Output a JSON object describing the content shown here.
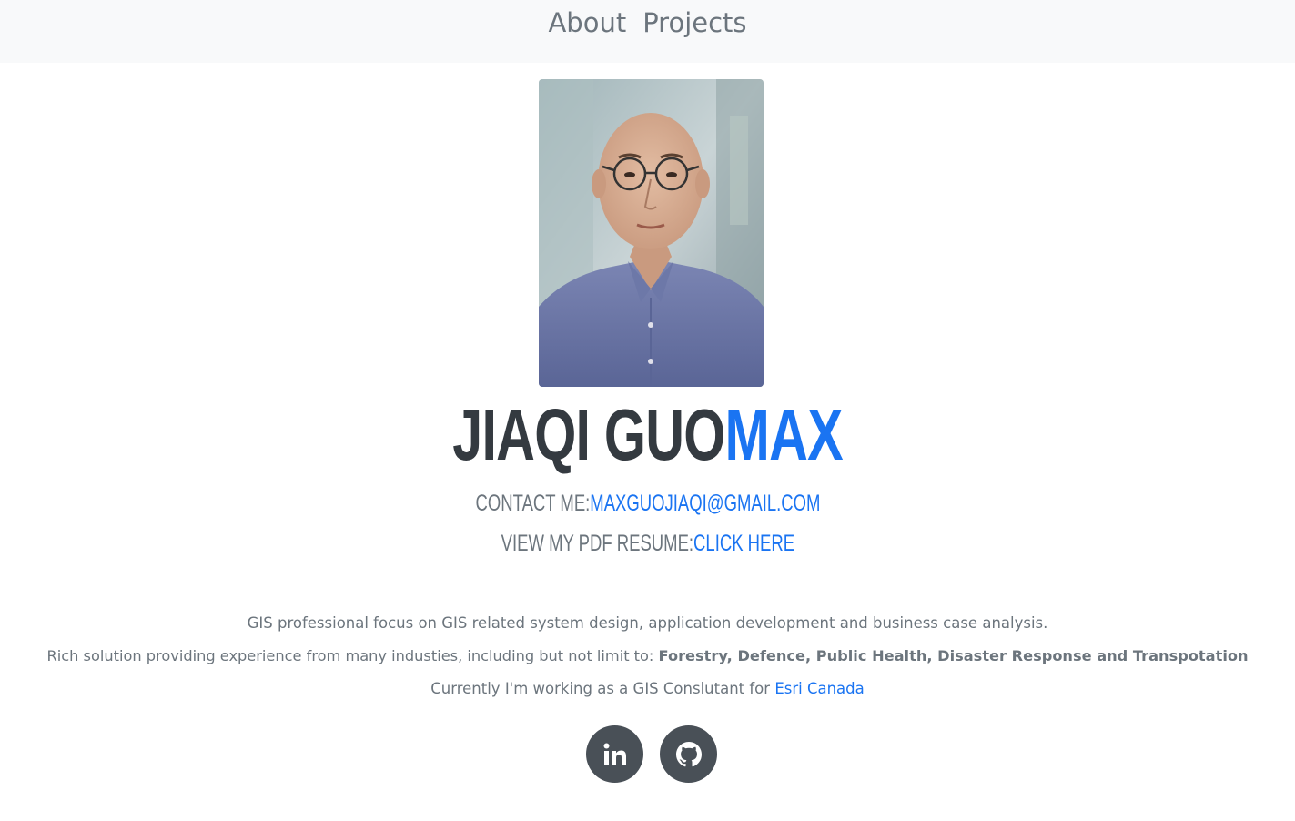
{
  "nav": {
    "items": [
      {
        "label": "About"
      },
      {
        "label": "Projects"
      }
    ]
  },
  "profile": {
    "first_name": "JIAQI GUO",
    "last_name": "MAX"
  },
  "contact": {
    "label": "CONTACT ME:",
    "email": "MAXGUOJIAQI@GMAIL.COM"
  },
  "resume": {
    "label": "VIEW MY PDF RESUME:",
    "link_text": "CLICK HERE"
  },
  "bio": {
    "line1": "GIS professional focus on GIS related system design, application development and business case analysis.",
    "line2_prefix": "Rich solution providing experience from many industies, including but not limit to: ",
    "line2_bold": "Forestry, Defence, Public Health, Disaster Response and Transpotation",
    "line3_prefix": "Currently I'm working as a GIS Conslutant for ",
    "line3_link": "Esri Canada"
  },
  "social": {
    "linkedin_icon": "linkedin-icon",
    "github_icon": "github-icon"
  },
  "colors": {
    "accent": "#1a74f2",
    "dark": "#343a40",
    "muted": "#6c757d",
    "navbar_bg": "#f8f9fa",
    "social_bg": "#495057"
  }
}
